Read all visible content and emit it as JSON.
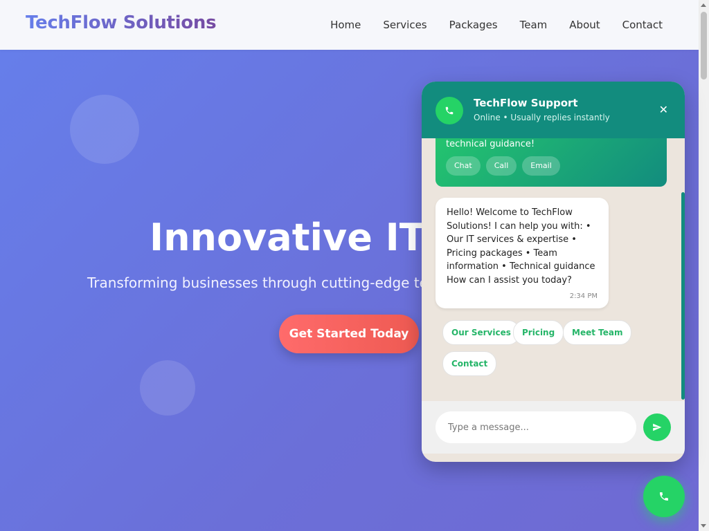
{
  "header": {
    "brand": "TechFlow Solutions",
    "nav": [
      "Home",
      "Services",
      "Packages",
      "Team",
      "About",
      "Contact"
    ]
  },
  "hero": {
    "title": "Innovative IT Sc",
    "subtitle": "Transforming businesses through cutting-edge techn",
    "cta_label": "Get Started Today"
  },
  "chat": {
    "title": "TechFlow Support",
    "status": "Online • Usually replies instantly",
    "close_symbol": "✕",
    "promo": {
      "text": "technical guidance!",
      "chips": [
        "Chat",
        "Call",
        "Email"
      ]
    },
    "bot_message": "Hello! Welcome to TechFlow Solutions! I can help you with: • Our IT services & expertise • Pricing packages • Team information • Technical guidance How can I assist you today?",
    "bot_time": "2:34 PM",
    "quick_replies": [
      "Our Services",
      "Pricing",
      "Meet Team",
      "Contact"
    ],
    "input_placeholder": "Type a message...",
    "send_icon": "send-icon",
    "phone_icon": "phone-icon"
  },
  "colors": {
    "brand_gradient": [
      "#667eea",
      "#764ba2"
    ],
    "hero_gradient": [
      "#667eea",
      "#6f6ad3"
    ],
    "cta_gradient": [
      "#ff6b6b",
      "#ee5a52"
    ],
    "chat_header": "#128c7e",
    "chat_accent": "#25d366"
  }
}
